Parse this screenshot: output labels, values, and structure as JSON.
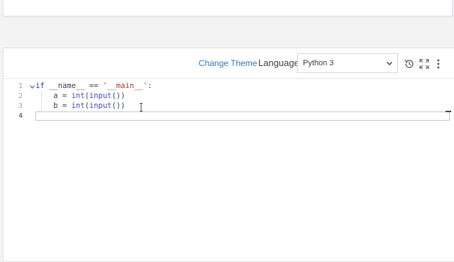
{
  "toolbar": {
    "change_theme": "Change Theme",
    "language_label": "Language",
    "language_value": "Python 3",
    "icons": [
      "history-icon",
      "fullscreen-icon",
      "more-vertical-icon"
    ]
  },
  "editor": {
    "line_numbers": [
      "1",
      "2",
      "3",
      "4"
    ],
    "lines": [
      {
        "tokens": [
          [
            "kw",
            "if"
          ],
          [
            "",
            " __name__ == "
          ],
          [
            "str",
            "'__main__'"
          ],
          [
            "",
            ":"
          ]
        ]
      },
      {
        "tokens": [
          [
            "",
            "    a = "
          ],
          [
            "fn",
            "int"
          ],
          [
            "",
            "("
          ],
          [
            "fn",
            "input"
          ],
          [
            "",
            "())"
          ]
        ]
      },
      {
        "tokens": [
          [
            "",
            "    b = "
          ],
          [
            "fn",
            "int"
          ],
          [
            "",
            "("
          ],
          [
            "fn",
            "input"
          ],
          [
            "",
            "())"
          ]
        ]
      },
      {
        "tokens": []
      }
    ]
  },
  "colors": {
    "accent_link": "#2b7bb9",
    "text": "#39424e",
    "keyword": "#1f3da8",
    "string": "#a33d1f"
  }
}
